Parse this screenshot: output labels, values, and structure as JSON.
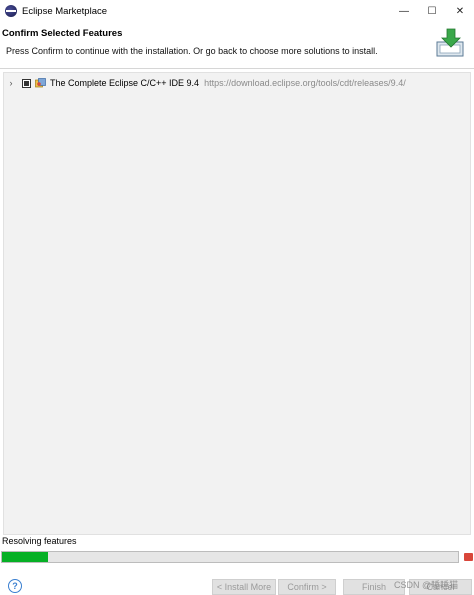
{
  "window": {
    "title": "Eclipse Marketplace",
    "controls": {
      "minimize": "—",
      "maximize": "☐",
      "close": "✕"
    }
  },
  "header": {
    "title": "Confirm Selected Features",
    "description": "Press Confirm to continue with the installation. Or go back to choose more solutions to install."
  },
  "tree": {
    "items": [
      {
        "expander": "›",
        "checked": true,
        "name": "The Complete Eclipse C/C++ IDE 9.4",
        "url": "https://download.eclipse.org/tools/cdt/releases/9.4/"
      }
    ]
  },
  "status": {
    "text": "Resolving features",
    "progress_fraction": 0.1,
    "progress_color": "#06b025"
  },
  "buttons": {
    "help": "?",
    "back": "< Install More",
    "confirm": "Confirm >",
    "finish": "Finish",
    "cancel": "Cancel"
  },
  "watermark": "CSDN @睡睡猫"
}
